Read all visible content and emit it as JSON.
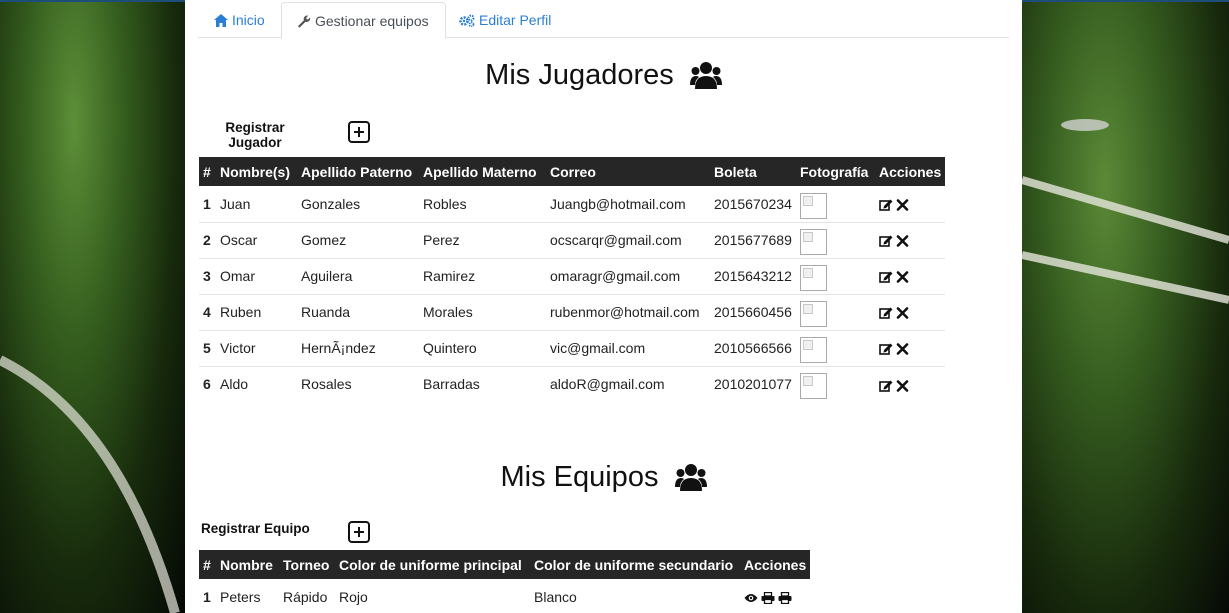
{
  "tabs": [
    {
      "label": "Inicio",
      "icon": "home-icon",
      "active": false
    },
    {
      "label": "Gestionar equipos",
      "icon": "wrench-icon",
      "active": true
    },
    {
      "label": "Editar Perfil",
      "icon": "gears-icon",
      "active": false
    }
  ],
  "players_section": {
    "title": "Mis Jugadores",
    "icon": "users-icon",
    "register_label_line1": "Registrar",
    "register_label_line2": "Jugador",
    "columns": [
      "#",
      "Nombre(s)",
      "Apellido Paterno",
      "Apellido Materno",
      "Correo",
      "Boleta",
      "Fotografía",
      "Acciones"
    ],
    "rows": [
      {
        "n": "1",
        "name": "Juan",
        "paterno": "Gonzales",
        "materno": "Robles",
        "email": "Juangb@hotmail.com",
        "boleta": "2015670234"
      },
      {
        "n": "2",
        "name": "Oscar",
        "paterno": "Gomez",
        "materno": "Perez",
        "email": "ocscarqr@gmail.com",
        "boleta": "2015677689"
      },
      {
        "n": "3",
        "name": "Omar",
        "paterno": "Aguilera",
        "materno": "Ramirez",
        "email": "omaragr@gmail.com",
        "boleta": "2015643212"
      },
      {
        "n": "4",
        "name": "Ruben",
        "paterno": "Ruanda",
        "materno": "Morales",
        "email": "rubenmor@hotmail.com",
        "boleta": "2015660456"
      },
      {
        "n": "5",
        "name": "Victor",
        "paterno": "HernÃ¡ndez",
        "materno": "Quintero",
        "email": "vic@gmail.com",
        "boleta": "2010566566"
      },
      {
        "n": "6",
        "name": "Aldo",
        "paterno": "Rosales",
        "materno": "Barradas",
        "email": "aldoR@gmail.com",
        "boleta": "2010201077"
      }
    ],
    "row_actions": [
      "edit-icon",
      "delete-icon"
    ]
  },
  "teams_section": {
    "title": "Mis Equipos",
    "icon": "users-icon",
    "register_label": "Registrar Equipo",
    "columns": [
      "#",
      "Nombre",
      "Torneo",
      "Color de uniforme principal",
      "Color de uniforme secundario",
      "Acciones"
    ],
    "rows": [
      {
        "n": "1",
        "name": "Peters",
        "torneo": "Rápido",
        "primary": "Rojo",
        "secondary": "Blanco"
      }
    ],
    "row_actions": [
      "eye-icon",
      "print-icon",
      "print-icon"
    ]
  },
  "colors": {
    "link": "#2a7fd4",
    "header_bg": "#262626",
    "accent_bar": "#1d4e7a"
  }
}
